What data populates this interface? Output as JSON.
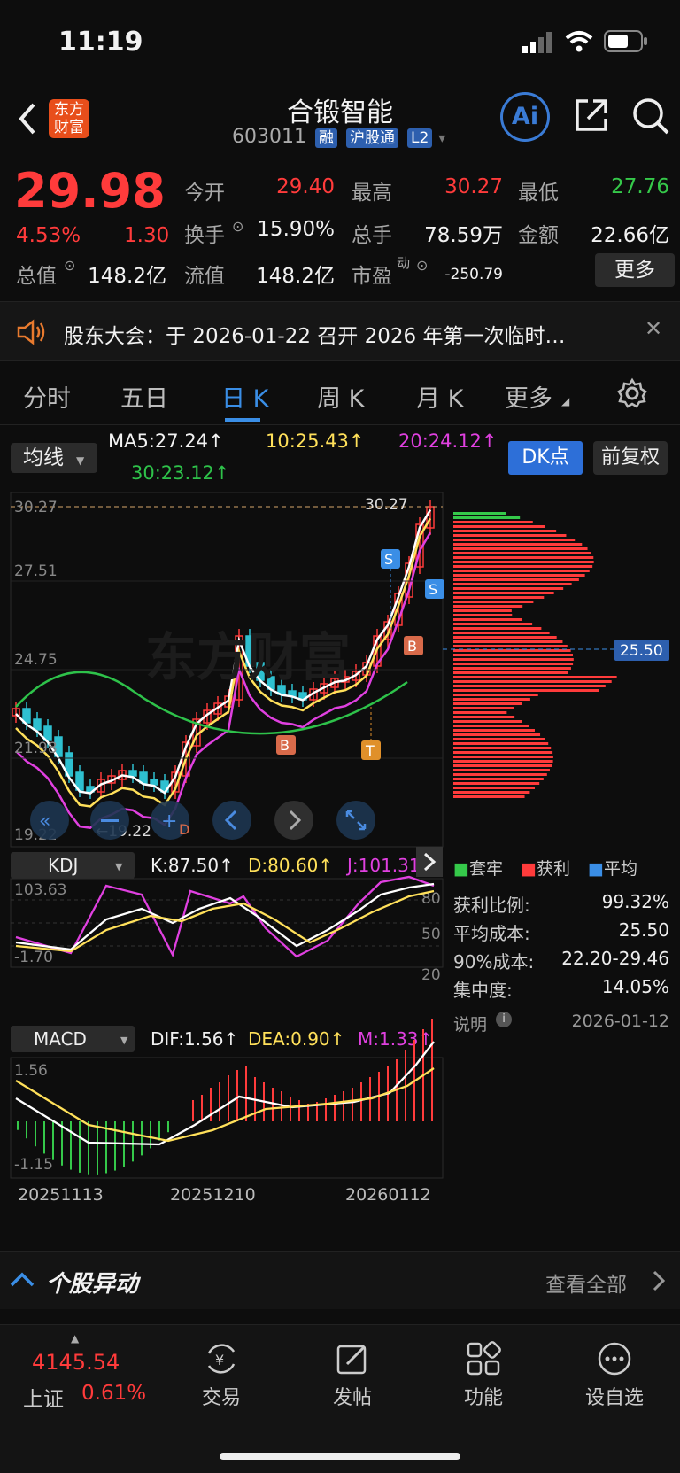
{
  "status": {
    "time": "11:19"
  },
  "header": {
    "logo_line1": "东方",
    "logo_line2": "财富",
    "title": "合锻智能",
    "code": "603011",
    "tag1": "融",
    "tag2": "沪股通",
    "tag3": "L2",
    "ai": "Ai"
  },
  "quote": {
    "price": "29.98",
    "pct": "4.53%",
    "chg": "1.30",
    "open_label": "今开",
    "open": "29.40",
    "high_label": "最高",
    "high": "30.27",
    "low_label": "最低",
    "low": "27.76",
    "turnover_label": "换手",
    "turnover": "15.90%",
    "vol_label": "总手",
    "vol": "78.59万",
    "amount_label": "金额",
    "amount": "22.66亿",
    "mcap_label": "总值",
    "mcap": "148.2亿",
    "float_label": "流值",
    "float": "148.2亿",
    "pe_label": "市盈",
    "pe_sup": "动",
    "pe": "-250.79",
    "more": "更多"
  },
  "notice": {
    "text": "股东大会：于 2026-01-22 召开 2026 年第一次临时…"
  },
  "tabs": {
    "t1": "分时",
    "t2": "五日",
    "t3": "日 K",
    "t4": "周 K",
    "t5": "月 K",
    "t6": "更多"
  },
  "ma": {
    "selector": "均线",
    "ma5": "MA5:27.24↑",
    "ma10": "10:25.43↑",
    "ma20": "20:24.12↑",
    "ma30": "30:23.12↑",
    "dk": "DK点",
    "fq": "前复权"
  },
  "kline": {
    "y1": "30.27",
    "y2": "27.51",
    "y3": "24.75",
    "y4": "21.98",
    "y5": "19.22",
    "hi": "30.27",
    "lo": "←19.22",
    "watermark": "东方财富",
    "avg_tag": "25.50",
    "b": "B",
    "s": "S",
    "t": "T",
    "d": "D"
  },
  "kdj": {
    "selector": "KDJ",
    "k": "K:87.50↑",
    "d": "D:80.60↑",
    "j": "J:101.31",
    "top": "103.63",
    "bot": "-1.70",
    "l80": "80",
    "l50": "50",
    "l20": "20"
  },
  "macd": {
    "selector": "MACD",
    "dif": "DIF:1.56↑",
    "dea": "DEA:0.90↑",
    "m": "M:1.33↑",
    "top": "1.56",
    "bot": "-1.15"
  },
  "dates": {
    "d1": "20251113",
    "d2": "20251210",
    "d3": "20260112"
  },
  "chip": {
    "leg1": "套牢",
    "leg2": "获利",
    "leg3": "平均",
    "r1l": "获利比例:",
    "r1v": "99.32%",
    "r2l": "平均成本:",
    "r2v": "25.50",
    "r3l": "90%成本:",
    "r3v": "22.20-29.46",
    "r4l": "集中度:",
    "r4v": "14.05%",
    "r5l": "说明",
    "r5v": "2026-01-12"
  },
  "movement": {
    "title": "个股异动",
    "all": "查看全部"
  },
  "bottom": {
    "index_val": "4145.54",
    "index_name": "上证",
    "index_pct": "0.61%",
    "n1": "交易",
    "n2": "发帖",
    "n3": "功能",
    "n4": "设自选"
  },
  "colors": {
    "up": "#ff3b3b",
    "down": "#35c94a",
    "accent": "#2d5fae"
  }
}
